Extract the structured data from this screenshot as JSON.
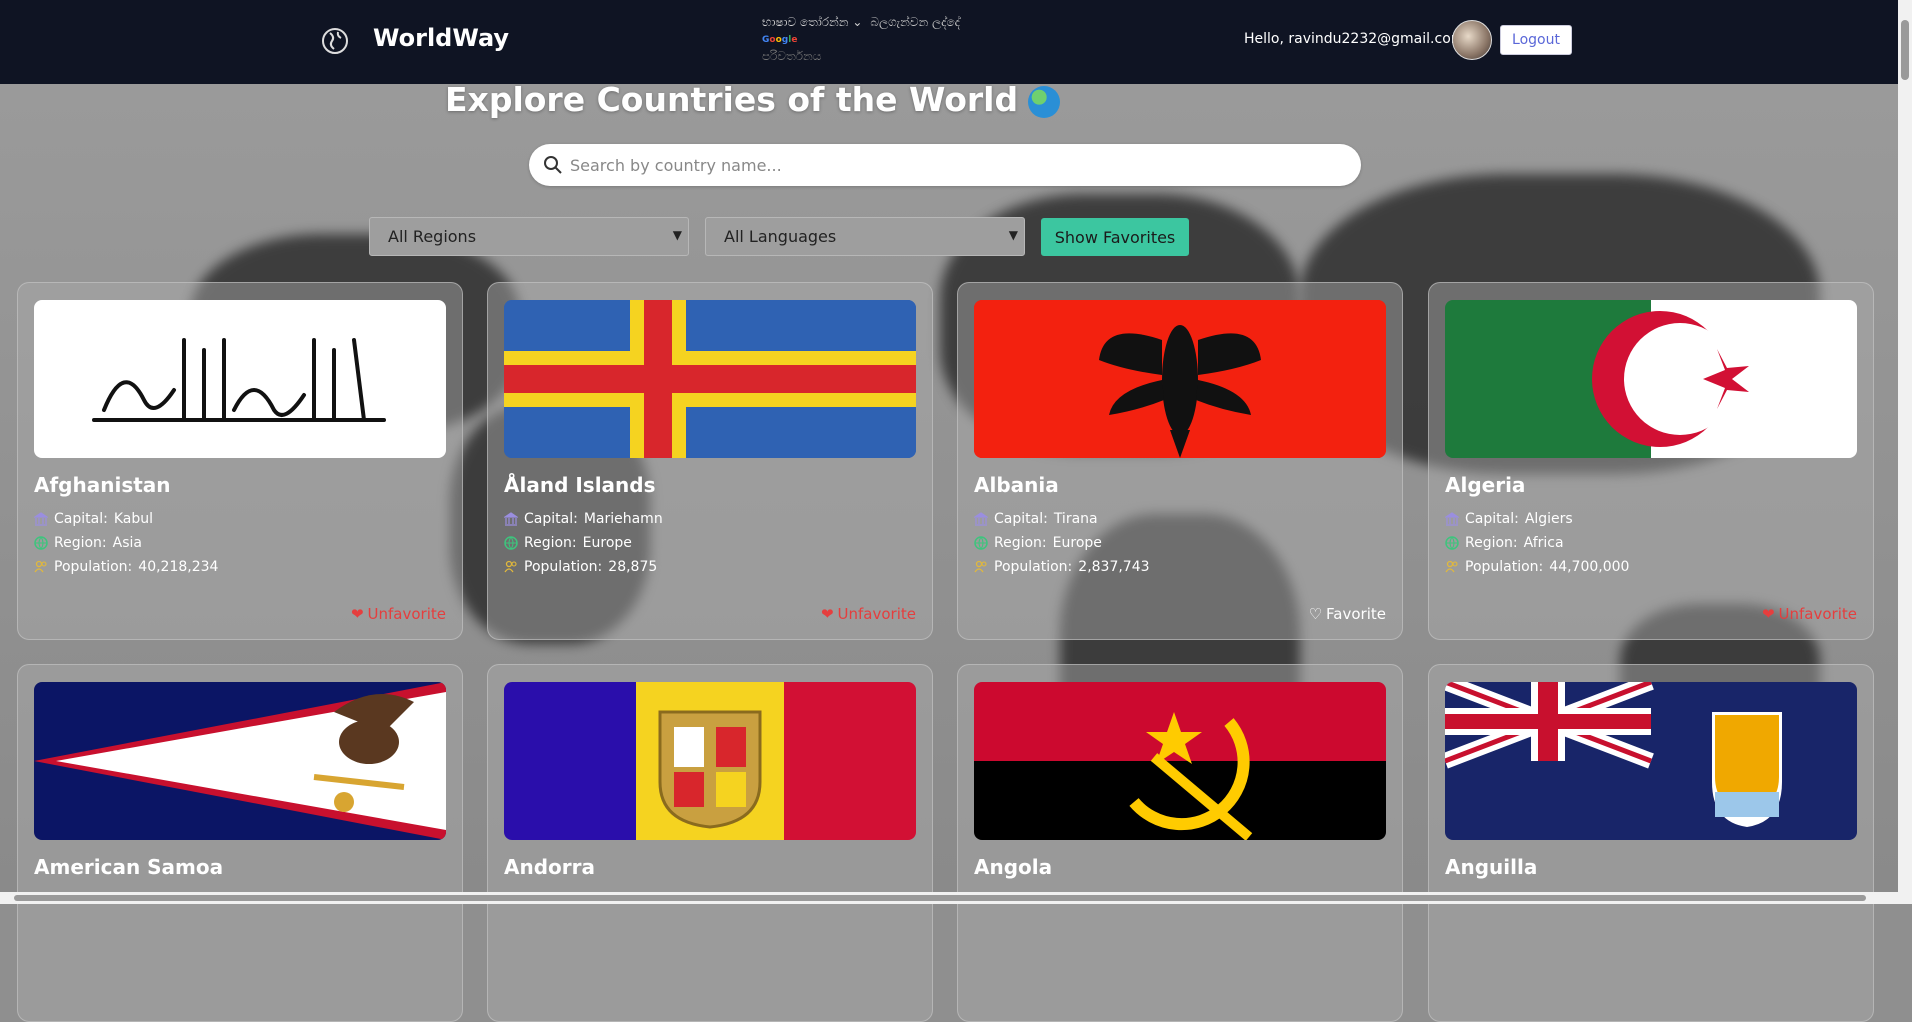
{
  "header": {
    "brand": "WorldWay",
    "translate_select": "භාෂාව තෝරන්න",
    "translate_powered_label": "බලගැන්වන ලද්දේ",
    "translate_google": "Google",
    "translate_service": "පරිවර්තනය",
    "greeting": "Hello, ravindu2232@gmail.com",
    "logout_label": "Logout"
  },
  "main": {
    "title": "Explore Countries of the World",
    "search_placeholder": "Search by country name...",
    "region_filter": "All Regions",
    "language_filter": "All Languages",
    "show_favorites": "Show Favorites"
  },
  "labels": {
    "capital": "Capital:",
    "region": "Region:",
    "population": "Population:"
  },
  "countries": [
    {
      "name": "Afghanistan",
      "capital": "Kabul",
      "region": "Asia",
      "population": "40,218,234",
      "fav_label": "Unfavorite"
    },
    {
      "name": "Åland Islands",
      "capital": "Mariehamn",
      "region": "Europe",
      "population": "28,875",
      "fav_label": "Unfavorite"
    },
    {
      "name": "Albania",
      "capital": "Tirana",
      "region": "Europe",
      "population": "2,837,743",
      "fav_label": "Favorite"
    },
    {
      "name": "Algeria",
      "capital": "Algiers",
      "region": "Africa",
      "population": "44,700,000",
      "fav_label": "Unfavorite"
    },
    {
      "name": "American Samoa"
    },
    {
      "name": "Andorra"
    },
    {
      "name": "Angola"
    },
    {
      "name": "Anguilla"
    }
  ],
  "colors": {
    "nav_bg": "#0f1423",
    "accent_green": "#3cc6a0",
    "favorite_red": "#e53e3e",
    "logout_text": "#5a67d8"
  }
}
